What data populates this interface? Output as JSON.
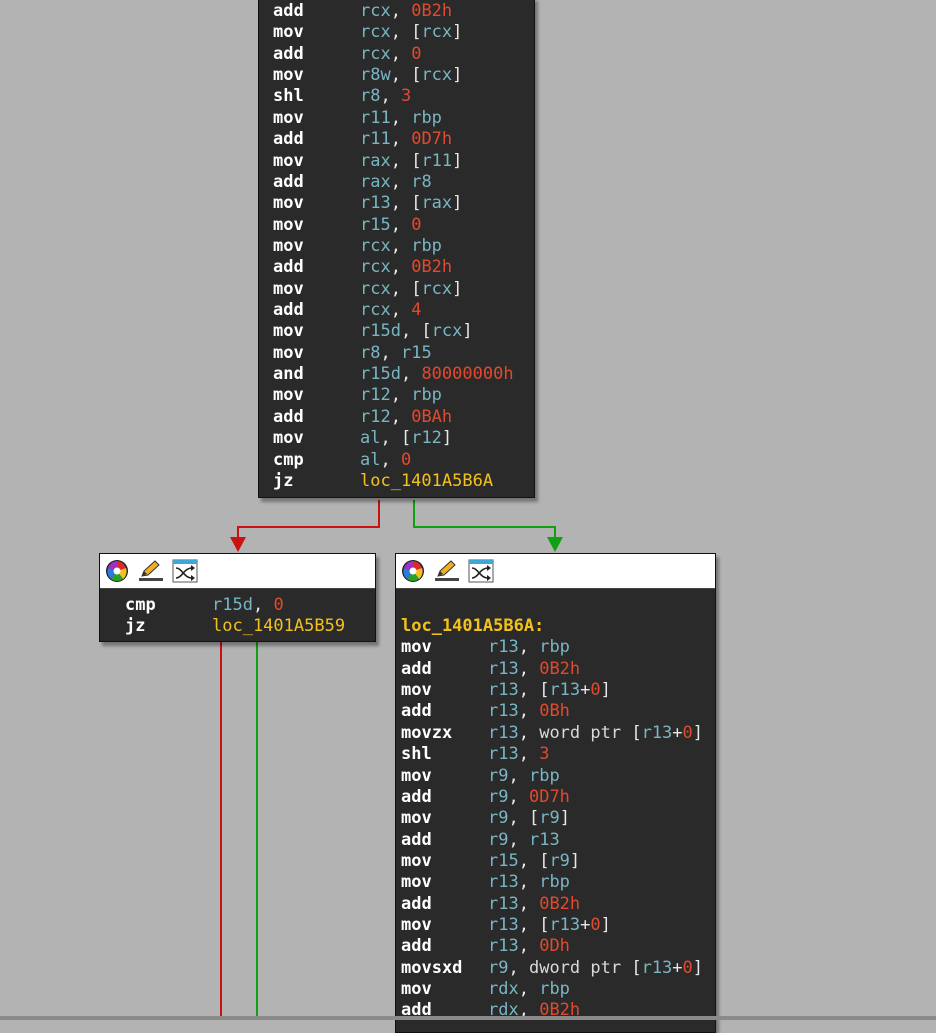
{
  "view": "IDA graph view",
  "colors": {
    "background": "#b3b3b3",
    "block_bg": "#2a2a2a",
    "mnemonic": "#ffffff",
    "register": "#78b6c4",
    "number": "#e2492e",
    "label": "#f2c21b",
    "keyword": "#d9d9d9",
    "edge_false": "#cc1111",
    "edge_true": "#11a011"
  },
  "header_icons": [
    "color-wheel-icon",
    "edit-pencil-icon",
    "shuffle-graph-icon"
  ],
  "top_block": {
    "lines": [
      {
        "mn": "add",
        "ops": [
          [
            "reg",
            "rcx"
          ],
          [
            "p",
            ", "
          ],
          [
            "num",
            "0B2h"
          ]
        ]
      },
      {
        "mn": "mov",
        "ops": [
          [
            "reg",
            "rcx"
          ],
          [
            "p",
            ", ["
          ],
          [
            "reg",
            "rcx"
          ],
          [
            "p",
            "]"
          ]
        ]
      },
      {
        "mn": "add",
        "ops": [
          [
            "reg",
            "rcx"
          ],
          [
            "p",
            ", "
          ],
          [
            "num",
            "0"
          ]
        ]
      },
      {
        "mn": "mov",
        "ops": [
          [
            "reg",
            "r8w"
          ],
          [
            "p",
            ", ["
          ],
          [
            "reg",
            "rcx"
          ],
          [
            "p",
            "]"
          ]
        ]
      },
      {
        "mn": "shl",
        "ops": [
          [
            "reg",
            "r8"
          ],
          [
            "p",
            ", "
          ],
          [
            "num",
            "3"
          ]
        ]
      },
      {
        "mn": "mov",
        "ops": [
          [
            "reg",
            "r11"
          ],
          [
            "p",
            ", "
          ],
          [
            "reg",
            "rbp"
          ]
        ]
      },
      {
        "mn": "add",
        "ops": [
          [
            "reg",
            "r11"
          ],
          [
            "p",
            ", "
          ],
          [
            "num",
            "0D7h"
          ]
        ]
      },
      {
        "mn": "mov",
        "ops": [
          [
            "reg",
            "rax"
          ],
          [
            "p",
            ", ["
          ],
          [
            "reg",
            "r11"
          ],
          [
            "p",
            "]"
          ]
        ]
      },
      {
        "mn": "add",
        "ops": [
          [
            "reg",
            "rax"
          ],
          [
            "p",
            ", "
          ],
          [
            "reg",
            "r8"
          ]
        ]
      },
      {
        "mn": "mov",
        "ops": [
          [
            "reg",
            "r13"
          ],
          [
            "p",
            ", ["
          ],
          [
            "reg",
            "rax"
          ],
          [
            "p",
            "]"
          ]
        ]
      },
      {
        "mn": "mov",
        "ops": [
          [
            "reg",
            "r15"
          ],
          [
            "p",
            ", "
          ],
          [
            "num",
            "0"
          ]
        ]
      },
      {
        "mn": "mov",
        "ops": [
          [
            "reg",
            "rcx"
          ],
          [
            "p",
            ", "
          ],
          [
            "reg",
            "rbp"
          ]
        ]
      },
      {
        "mn": "add",
        "ops": [
          [
            "reg",
            "rcx"
          ],
          [
            "p",
            ", "
          ],
          [
            "num",
            "0B2h"
          ]
        ]
      },
      {
        "mn": "mov",
        "ops": [
          [
            "reg",
            "rcx"
          ],
          [
            "p",
            ", ["
          ],
          [
            "reg",
            "rcx"
          ],
          [
            "p",
            "]"
          ]
        ]
      },
      {
        "mn": "add",
        "ops": [
          [
            "reg",
            "rcx"
          ],
          [
            "p",
            ", "
          ],
          [
            "num",
            "4"
          ]
        ]
      },
      {
        "mn": "mov",
        "ops": [
          [
            "reg",
            "r15d"
          ],
          [
            "p",
            ", ["
          ],
          [
            "reg",
            "rcx"
          ],
          [
            "p",
            "]"
          ]
        ]
      },
      {
        "mn": "mov",
        "ops": [
          [
            "reg",
            "r8"
          ],
          [
            "p",
            ", "
          ],
          [
            "reg",
            "r15"
          ]
        ]
      },
      {
        "mn": "and",
        "ops": [
          [
            "reg",
            "r15d"
          ],
          [
            "p",
            ", "
          ],
          [
            "num",
            "80000000h"
          ]
        ]
      },
      {
        "mn": "mov",
        "ops": [
          [
            "reg",
            "r12"
          ],
          [
            "p",
            ", "
          ],
          [
            "reg",
            "rbp"
          ]
        ]
      },
      {
        "mn": "add",
        "ops": [
          [
            "reg",
            "r12"
          ],
          [
            "p",
            ", "
          ],
          [
            "num",
            "0BAh"
          ]
        ]
      },
      {
        "mn": "mov",
        "ops": [
          [
            "reg",
            "al"
          ],
          [
            "p",
            ", ["
          ],
          [
            "reg",
            "r12"
          ],
          [
            "p",
            "]"
          ]
        ]
      },
      {
        "mn": "cmp",
        "ops": [
          [
            "reg",
            "al"
          ],
          [
            "p",
            ", "
          ],
          [
            "num",
            "0"
          ]
        ]
      },
      {
        "mn": "jz",
        "ops": [
          [
            "name",
            "loc_1401A5B6A"
          ]
        ]
      }
    ]
  },
  "left_block": {
    "lines": [
      {
        "mn": "cmp",
        "ops": [
          [
            "reg",
            "r15d"
          ],
          [
            "p",
            ", "
          ],
          [
            "num",
            "0"
          ]
        ]
      },
      {
        "mn": "jz",
        "ops": [
          [
            "name",
            "loc_1401A5B59"
          ]
        ]
      }
    ]
  },
  "right_block": {
    "label": "loc_1401A5B6A:",
    "lines": [
      {
        "mn": "mov",
        "ops": [
          [
            "reg",
            "r13"
          ],
          [
            "p",
            ", "
          ],
          [
            "reg",
            "rbp"
          ]
        ]
      },
      {
        "mn": "add",
        "ops": [
          [
            "reg",
            "r13"
          ],
          [
            "p",
            ", "
          ],
          [
            "num",
            "0B2h"
          ]
        ]
      },
      {
        "mn": "mov",
        "ops": [
          [
            "reg",
            "r13"
          ],
          [
            "p",
            ", ["
          ],
          [
            "reg",
            "r13"
          ],
          [
            "p",
            "+"
          ],
          [
            "num",
            "0"
          ],
          [
            "p",
            "]"
          ]
        ]
      },
      {
        "mn": "add",
        "ops": [
          [
            "reg",
            "r13"
          ],
          [
            "p",
            ", "
          ],
          [
            "num",
            "0Bh"
          ]
        ]
      },
      {
        "mn": "movzx",
        "ops": [
          [
            "reg",
            "r13"
          ],
          [
            "p",
            ", "
          ],
          [
            "kw",
            "word ptr "
          ],
          [
            "p",
            "["
          ],
          [
            "reg",
            "r13"
          ],
          [
            "p",
            "+"
          ],
          [
            "num",
            "0"
          ],
          [
            "p",
            "]"
          ]
        ]
      },
      {
        "mn": "shl",
        "ops": [
          [
            "reg",
            "r13"
          ],
          [
            "p",
            ", "
          ],
          [
            "num",
            "3"
          ]
        ]
      },
      {
        "mn": "mov",
        "ops": [
          [
            "reg",
            "r9"
          ],
          [
            "p",
            ", "
          ],
          [
            "reg",
            "rbp"
          ]
        ]
      },
      {
        "mn": "add",
        "ops": [
          [
            "reg",
            "r9"
          ],
          [
            "p",
            ", "
          ],
          [
            "num",
            "0D7h"
          ]
        ]
      },
      {
        "mn": "mov",
        "ops": [
          [
            "reg",
            "r9"
          ],
          [
            "p",
            ", ["
          ],
          [
            "reg",
            "r9"
          ],
          [
            "p",
            "]"
          ]
        ]
      },
      {
        "mn": "add",
        "ops": [
          [
            "reg",
            "r9"
          ],
          [
            "p",
            ", "
          ],
          [
            "reg",
            "r13"
          ]
        ]
      },
      {
        "mn": "mov",
        "ops": [
          [
            "reg",
            "r15"
          ],
          [
            "p",
            ", ["
          ],
          [
            "reg",
            "r9"
          ],
          [
            "p",
            "]"
          ]
        ]
      },
      {
        "mn": "mov",
        "ops": [
          [
            "reg",
            "r13"
          ],
          [
            "p",
            ", "
          ],
          [
            "reg",
            "rbp"
          ]
        ]
      },
      {
        "mn": "add",
        "ops": [
          [
            "reg",
            "r13"
          ],
          [
            "p",
            ", "
          ],
          [
            "num",
            "0B2h"
          ]
        ]
      },
      {
        "mn": "mov",
        "ops": [
          [
            "reg",
            "r13"
          ],
          [
            "p",
            ", ["
          ],
          [
            "reg",
            "r13"
          ],
          [
            "p",
            "+"
          ],
          [
            "num",
            "0"
          ],
          [
            "p",
            "]"
          ]
        ]
      },
      {
        "mn": "add",
        "ops": [
          [
            "reg",
            "r13"
          ],
          [
            "p",
            ", "
          ],
          [
            "num",
            "0Dh"
          ]
        ]
      },
      {
        "mn": "movsxd",
        "ops": [
          [
            "reg",
            "r9"
          ],
          [
            "p",
            ", "
          ],
          [
            "kw",
            "dword ptr "
          ],
          [
            "p",
            "["
          ],
          [
            "reg",
            "r13"
          ],
          [
            "p",
            "+"
          ],
          [
            "num",
            "0"
          ],
          [
            "p",
            "]"
          ]
        ]
      },
      {
        "mn": "mov",
        "ops": [
          [
            "reg",
            "rdx"
          ],
          [
            "p",
            ", "
          ],
          [
            "reg",
            "rbp"
          ]
        ]
      },
      {
        "mn": "add",
        "ops": [
          [
            "reg",
            "rdx"
          ],
          [
            "p",
            ", "
          ],
          [
            "num",
            "0B2h"
          ]
        ]
      }
    ]
  }
}
